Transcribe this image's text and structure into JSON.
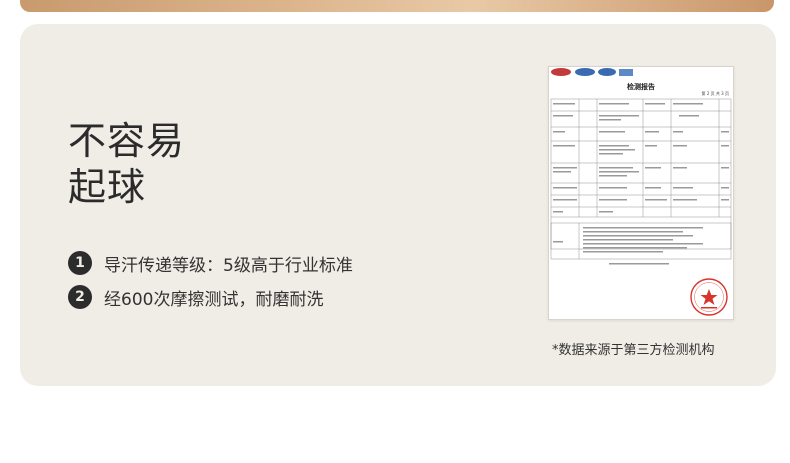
{
  "headline": {
    "line1": "不容易",
    "line2": "起球"
  },
  "features": [
    {
      "num": "1",
      "text": "导汗传递等级：5级高于行业标准"
    },
    {
      "num": "2",
      "text": "经600次摩擦测试，耐磨耐洗"
    }
  ],
  "report": {
    "title": "检测报告",
    "page": "第 2 页 共 3 页"
  },
  "source_note": "*数据来源于第三方检测机构",
  "colors": {
    "card_bg": "#f0ede6",
    "accent_dark": "#2c2c2c",
    "stamp_red": "#d9342b"
  }
}
